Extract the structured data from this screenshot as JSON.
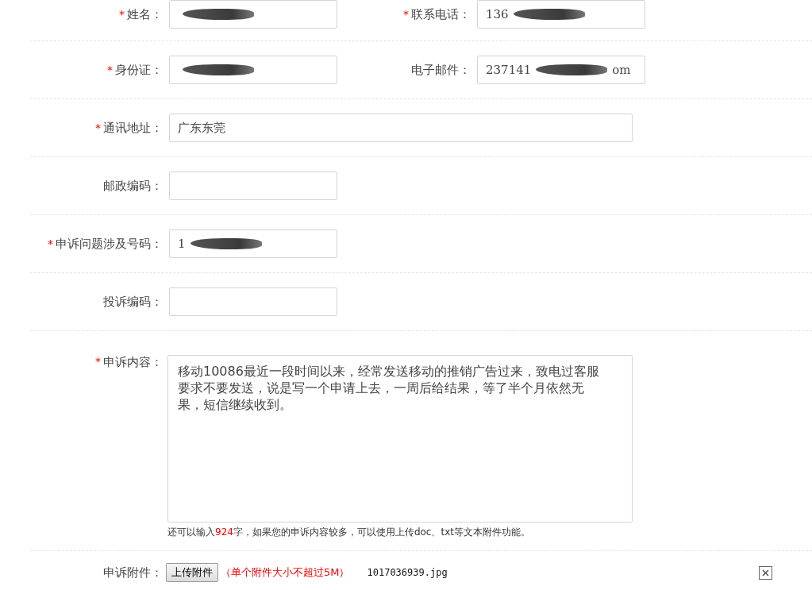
{
  "required_mark": "*",
  "rows": [
    {
      "fields": [
        {
          "label": "姓名：",
          "required": true,
          "redacted": true
        },
        {
          "label": "联系电话：",
          "required": true,
          "value": "136",
          "redacted": true
        }
      ]
    },
    {
      "fields": [
        {
          "label": "身份证：",
          "required": true,
          "redacted": true
        },
        {
          "label": "电子邮件：",
          "value": "237141",
          "value_tail": "om",
          "redacted": true
        }
      ]
    },
    {
      "fields": [
        {
          "label": "通讯地址：",
          "required": true,
          "value": "广东东莞",
          "kind": "wide"
        }
      ]
    },
    {
      "fields": [
        {
          "label": "邮政编码："
        }
      ]
    },
    {
      "fields": [
        {
          "label": "申诉问题涉及号码：",
          "required": true,
          "value": "1",
          "redacted": true
        }
      ]
    },
    {
      "fields": [
        {
          "label": "投诉编码："
        }
      ]
    }
  ],
  "content": {
    "label": "申诉内容：",
    "required": true,
    "value": "移动10086最近一段时间以来，经常发送移动的推销广告过来，致电过客服要求不要发送，说是写一个申请上去，一周后给结果，等了半个月依然无果，短信继续收到。",
    "hint_before": "还可以输入",
    "hint_count": "924",
    "hint_after": "字，如果您的申诉内容较多，可以使用上传doc、txt等文本附件功能。"
  },
  "attachment": {
    "label": "申诉附件：",
    "button": "上传附件",
    "note": "（单个附件大小不超过5M）",
    "file": "1017036939.jpg"
  }
}
